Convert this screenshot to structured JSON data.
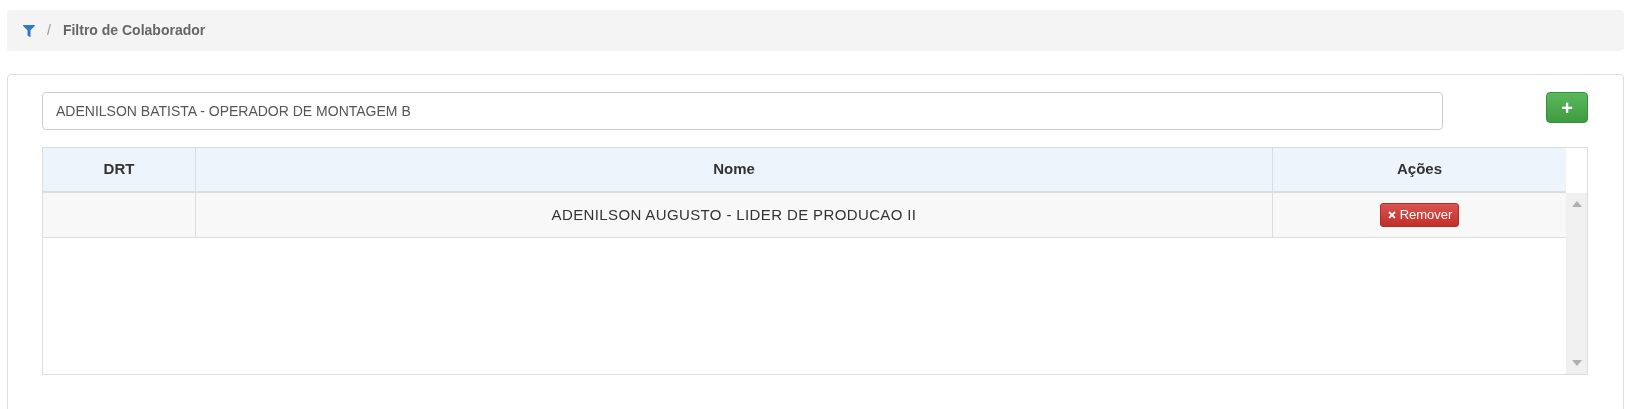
{
  "breadcrumb": {
    "separator": "/",
    "title": "Filtro de Colaborador"
  },
  "search": {
    "value": "ADENILSON BATISTA - OPERADOR DE MONTAGEM B"
  },
  "add_button": {
    "label": "+"
  },
  "table": {
    "columns": [
      "DRT",
      "Nome",
      "Ações"
    ],
    "rows": [
      {
        "drt": "",
        "nome": "ADENILSON AUGUSTO - LIDER DE PRODUCAO II",
        "action": "Remover"
      }
    ]
  }
}
